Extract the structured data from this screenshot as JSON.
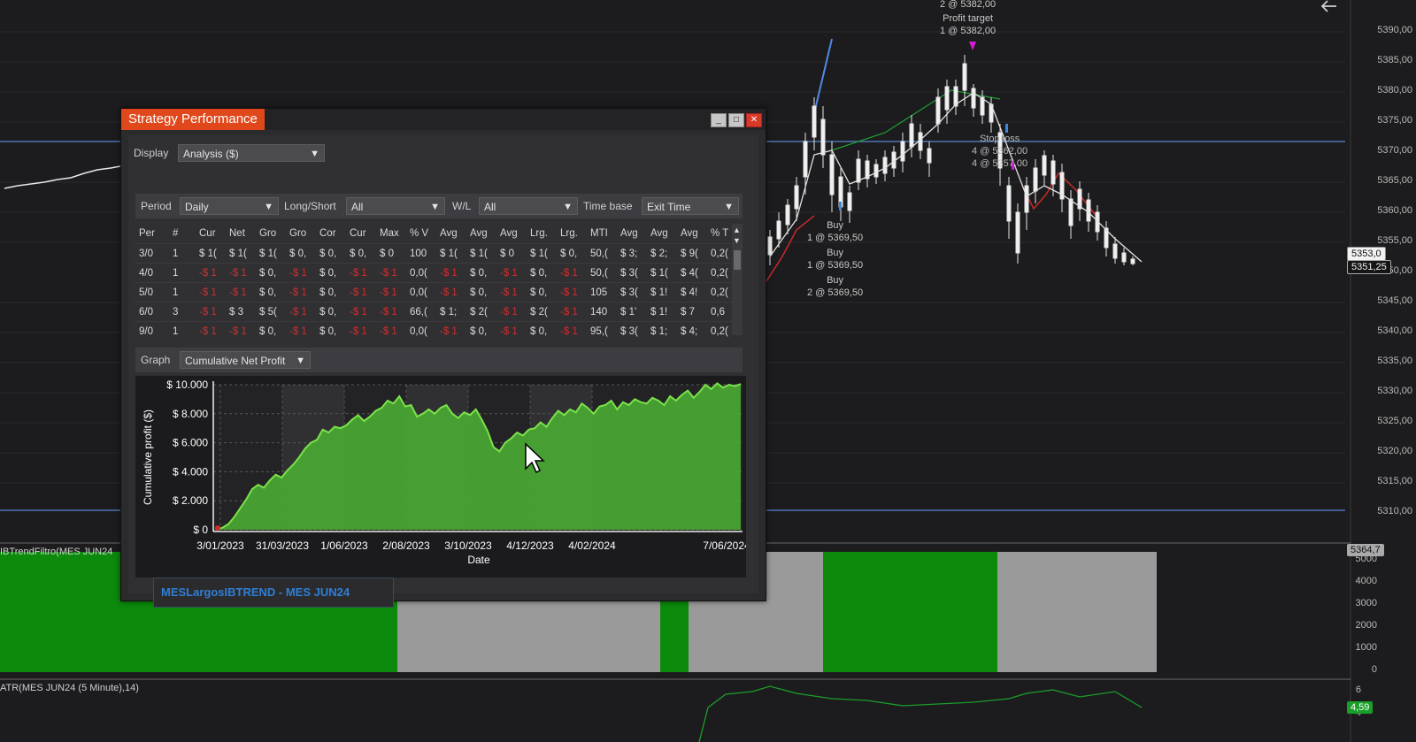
{
  "colors": {
    "accent": "#e0471b",
    "profit_fill": "#4aa832",
    "profit_line": "#7be34a",
    "loss": "#d42c2c",
    "pane_green": "#0c8a0c",
    "pane_gray": "#9a9a9a",
    "hline": "#4f74b3"
  },
  "price_axis": [
    "5390,00",
    "5385,00",
    "5380,00",
    "5375,00",
    "5370,00",
    "5365,00",
    "5360,00",
    "5355,00",
    "5350,00",
    "5345,00",
    "5340,00",
    "5335,00",
    "5330,00",
    "5325,00",
    "5320,00",
    "5315,00",
    "5310,00"
  ],
  "price_boxes": {
    "top": "5353,0",
    "mid": "5351,25",
    "pane": "5364,7",
    "atr": "4,59"
  },
  "trend_axis": [
    "5000",
    "4000",
    "3000",
    "2000",
    "1000",
    "0"
  ],
  "atr_axis": [
    "6",
    "4"
  ],
  "annotations": {
    "top_partial": "2 @ 5382,00",
    "profit_target": "Profit target\n1 @ 5382,00",
    "stop_loss": "Stop loss\n4 @ 5362,00\n4 @ 5357,00",
    "buy1": "Buy\n1 @ 5369,50",
    "buy2": "Buy\n1 @ 5369,50",
    "buy3": "Buy\n2 @ 5369,50"
  },
  "panes": {
    "trend_title": "IBTrendFiltro(MES JUN24",
    "atr_title": "ATR(MES JUN24 (5 Minute),14)"
  },
  "window": {
    "title": "Strategy Performance",
    "minimize": "_",
    "maximize": "□",
    "close": "✕",
    "display_label": "Display",
    "display_value": "Analysis ($)",
    "period_label": "Period",
    "period_value": "Daily",
    "longshort_label": "Long/Short",
    "longshort_value": "All",
    "wl_label": "W/L",
    "wl_value": "All",
    "timebase_label": "Time base",
    "timebase_value": "Exit Time",
    "graph_label": "Graph",
    "graph_value": "Cumulative Net Profit",
    "tab": "MESLargosIBTREND - MES JUN24"
  },
  "table": {
    "headers": [
      "Per",
      "#",
      "Cur",
      "Net",
      "Gro",
      "Gro",
      "Cor",
      "Cur",
      "Max",
      "% V",
      "Avg",
      "Avg",
      "Avg",
      "Lrg.",
      "Lrg.",
      "MTI",
      "Avg",
      "Avg",
      "Avg",
      "% T"
    ],
    "rows": [
      [
        [
          "3/0",
          0
        ],
        [
          "1",
          0
        ],
        [
          "$ 1(",
          0
        ],
        [
          "$ 1(",
          0
        ],
        [
          "$ 1(",
          0
        ],
        [
          "$ 0,",
          0
        ],
        [
          "$ 0,",
          0
        ],
        [
          "$ 0,",
          0
        ],
        [
          "$ 0",
          0
        ],
        [
          "100",
          0
        ],
        [
          "$ 1(",
          0
        ],
        [
          "$ 1(",
          0
        ],
        [
          "$ 0",
          0
        ],
        [
          "$ 1(",
          0
        ],
        [
          "$ 0,",
          0
        ],
        [
          "50,(",
          0
        ],
        [
          "$ 3;",
          0
        ],
        [
          "$ 2;",
          0
        ],
        [
          "$ 9(",
          0
        ],
        [
          "0,2(",
          0
        ]
      ],
      [
        [
          "4/0",
          0
        ],
        [
          "1",
          0
        ],
        [
          "-$ 1",
          1
        ],
        [
          "-$ 1",
          1
        ],
        [
          "$ 0,",
          0
        ],
        [
          "-$ 1",
          1
        ],
        [
          "$ 0,",
          0
        ],
        [
          "-$ 1",
          1
        ],
        [
          "-$ 1",
          1
        ],
        [
          "0,0(",
          0
        ],
        [
          "-$ 1",
          1
        ],
        [
          "$ 0,",
          0
        ],
        [
          "-$ 1",
          1
        ],
        [
          "$ 0,",
          0
        ],
        [
          "-$ 1",
          1
        ],
        [
          "50,(",
          0
        ],
        [
          "$ 3(",
          0
        ],
        [
          "$ 1(",
          0
        ],
        [
          "$ 4(",
          0
        ],
        [
          "0,2(",
          0
        ]
      ],
      [
        [
          "5/0",
          0
        ],
        [
          "1",
          0
        ],
        [
          "-$ 1",
          1
        ],
        [
          "-$ 1",
          1
        ],
        [
          "$ 0,",
          0
        ],
        [
          "-$ 1",
          1
        ],
        [
          "$ 0,",
          0
        ],
        [
          "-$ 1",
          1
        ],
        [
          "-$ 1",
          1
        ],
        [
          "0,0(",
          0
        ],
        [
          "-$ 1",
          1
        ],
        [
          "$ 0,",
          0
        ],
        [
          "-$ 1",
          1
        ],
        [
          "$ 0,",
          0
        ],
        [
          "-$ 1",
          1
        ],
        [
          "105",
          0
        ],
        [
          "$ 3(",
          0
        ],
        [
          "$ 1!",
          0
        ],
        [
          "$ 4!",
          0
        ],
        [
          "0,2(",
          0
        ]
      ],
      [
        [
          "6/0",
          0
        ],
        [
          "3",
          0
        ],
        [
          "-$ 1",
          1
        ],
        [
          "$ 3",
          0
        ],
        [
          "$ 5(",
          0
        ],
        [
          "-$ 1",
          1
        ],
        [
          "$ 0,",
          0
        ],
        [
          "-$ 1",
          1
        ],
        [
          "-$ 1",
          1
        ],
        [
          "66,(",
          0
        ],
        [
          "$ 1;",
          0
        ],
        [
          "$ 2(",
          0
        ],
        [
          "-$ 1",
          1
        ],
        [
          "$ 2(",
          0
        ],
        [
          "-$ 1",
          1
        ],
        [
          "140",
          0
        ],
        [
          "$ 1'",
          0
        ],
        [
          "$ 1!",
          0
        ],
        [
          "$ 7",
          0
        ],
        [
          "0,6",
          0
        ]
      ],
      [
        [
          "9/0",
          0
        ],
        [
          "1",
          0
        ],
        [
          "-$ 1",
          1
        ],
        [
          "-$ 1",
          1
        ],
        [
          "$ 0,",
          0
        ],
        [
          "-$ 1",
          1
        ],
        [
          "$ 0,",
          0
        ],
        [
          "-$ 1",
          1
        ],
        [
          "-$ 1",
          1
        ],
        [
          "0,0(",
          0
        ],
        [
          "-$ 1",
          1
        ],
        [
          "$ 0,",
          0
        ],
        [
          "-$ 1",
          1
        ],
        [
          "$ 0,",
          0
        ],
        [
          "-$ 1",
          1
        ],
        [
          "95,(",
          0
        ],
        [
          "$ 3(",
          0
        ],
        [
          "$ 1;",
          0
        ],
        [
          "$ 4;",
          0
        ],
        [
          "0,2(",
          0
        ]
      ]
    ]
  },
  "chart_data": {
    "type": "area",
    "title": "",
    "xlabel": "Date",
    "ylabel": "Cumulative profit ($)",
    "ylim": [
      0,
      10000
    ],
    "y_ticks": [
      {
        "v": 0,
        "label": "$ 0"
      },
      {
        "v": 2000,
        "label": "$ 2.000"
      },
      {
        "v": 4000,
        "label": "$ 4.000"
      },
      {
        "v": 6000,
        "label": "$ 6.000"
      },
      {
        "v": 8000,
        "label": "$ 8.000"
      },
      {
        "v": 10000,
        "label": "$ 10.000"
      }
    ],
    "x_tick_labels": [
      "3/01/2023",
      "31/03/2023",
      "1/06/2023",
      "2/08/2023",
      "3/10/2023",
      "4/12/2023",
      "4/02/2024",
      "7/06/2024"
    ],
    "grid": true,
    "series": [
      {
        "values": [
          0,
          150,
          400,
          900,
          1500,
          2100,
          2800,
          3100,
          2900,
          3400,
          3800,
          3600,
          4100,
          4500,
          5000,
          5600,
          6000,
          6200,
          6900,
          6700,
          7100,
          7000,
          7200,
          7600,
          7900,
          7500,
          7800,
          8200,
          8400,
          8900,
          8700,
          9200,
          8500,
          8600,
          7800,
          8000,
          8300,
          8000,
          8400,
          8600,
          8000,
          7700,
          8100,
          7900,
          8300,
          7600,
          6800,
          5700,
          5400,
          6000,
          6300,
          6700,
          6500,
          6900,
          7000,
          7400,
          7100,
          7700,
          8200,
          7900,
          8300,
          8100,
          8700,
          8400,
          8000,
          8500,
          8600,
          8900,
          8300,
          8800,
          8600,
          9000,
          8800,
          8700,
          9100,
          8900,
          8600,
          9200,
          8900,
          9300,
          9600,
          9100,
          9500,
          10000,
          9700,
          10100,
          9800,
          10000,
          9900,
          10050
        ]
      }
    ]
  }
}
